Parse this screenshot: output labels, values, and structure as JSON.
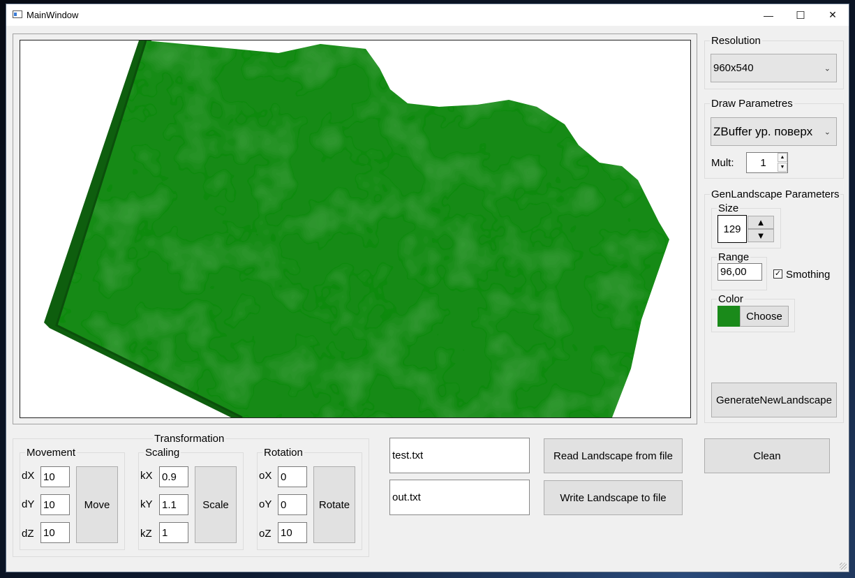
{
  "window": {
    "title": "MainWindow",
    "minimize": "—",
    "maximize": "☐",
    "close": "✕"
  },
  "resolution": {
    "title": "Resolution",
    "selected": "960x540"
  },
  "draw_params": {
    "title": "Draw Parametres",
    "selected": "ZBuffer ур. поверх",
    "mult_label": "Mult:",
    "mult_value": "1"
  },
  "gen_params": {
    "title": "GenLandscape Parameters",
    "size_label": "Size",
    "size_value": "129",
    "range_label": "Range",
    "range_value": "96,00",
    "smoothing_label": "Smothing",
    "smoothing_checked": true,
    "color_label": "Color",
    "color_value": "#1a8a1a",
    "choose_button": "Choose",
    "generate_button": "GenerateNewLandscape"
  },
  "transformation": {
    "title": "Transformation",
    "movement": {
      "title": "Movement",
      "labels": [
        "dX",
        "dY",
        "dZ"
      ],
      "values": [
        "10",
        "10",
        "10"
      ],
      "button": "Move"
    },
    "scaling": {
      "title": "Scaling",
      "labels": [
        "kX",
        "kY",
        "kZ"
      ],
      "values": [
        "0.9",
        "1.1",
        "1"
      ],
      "button": "Scale"
    },
    "rotation": {
      "title": "Rotation",
      "labels": [
        "oX",
        "oY",
        "oZ"
      ],
      "values": [
        "0",
        "0",
        "10"
      ],
      "button": "Rotate"
    }
  },
  "files": {
    "input_file": "test.txt",
    "output_file": "out.txt",
    "read_button": "Read Landscape from file",
    "write_button": "Write Landscape to file"
  },
  "clean_button": "Clean",
  "landscape_colors": {
    "surface": "#178a17",
    "dark": "#0f6a0f",
    "side": "#0e5e0e"
  }
}
